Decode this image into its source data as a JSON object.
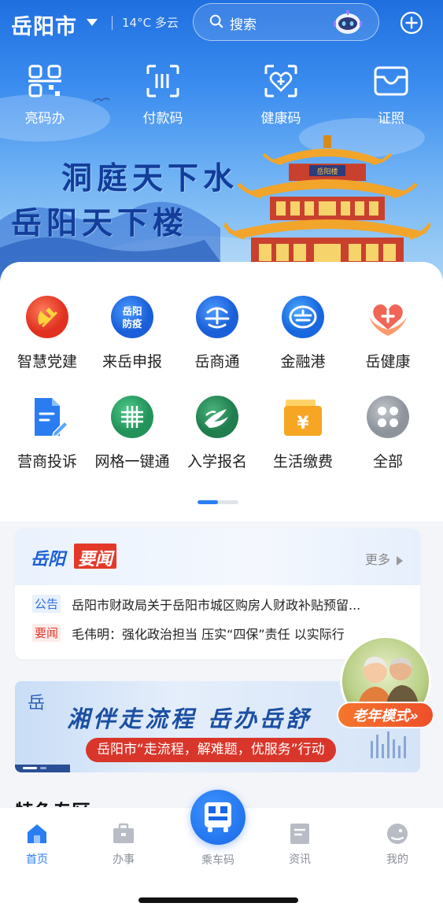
{
  "header": {
    "city": "岳阳市",
    "weather": "14°C 多云",
    "search_placeholder": "搜索"
  },
  "quick_actions": [
    {
      "label": "亮码办",
      "icon": "qr-scan-icon"
    },
    {
      "label": "付款码",
      "icon": "pay-code-icon"
    },
    {
      "label": "健康码",
      "icon": "health-code-icon"
    },
    {
      "label": "证照",
      "icon": "id-card-icon"
    }
  ],
  "hero": {
    "slogan_line1": "洞庭天下水",
    "slogan_line2": "岳阳天下楼",
    "tower_plaque": "岳阳楼"
  },
  "apps": [
    {
      "label": "智慧党建",
      "icon": "party-building-icon",
      "color": "#e8412c",
      "badge": ""
    },
    {
      "label": "来岳申报",
      "icon": "epidemic-prevention-icon",
      "color": "#1f6fe6",
      "badge": "岳阳\n防疫"
    },
    {
      "label": "岳商通",
      "icon": "business-icon",
      "color": "#1f6fe6",
      "badge": ""
    },
    {
      "label": "金融港",
      "icon": "finance-icon",
      "color": "#1f78e8",
      "badge": ""
    },
    {
      "label": "岳健康",
      "icon": "health-heart-icon",
      "color": "#ef5a4e",
      "badge": ""
    },
    {
      "label": "营商投诉",
      "icon": "complaint-doc-icon",
      "color": "#2a7cf0",
      "badge": ""
    },
    {
      "label": "网格一键通",
      "icon": "grid-icon",
      "color": "#2fa86c",
      "badge": ""
    },
    {
      "label": "入学报名",
      "icon": "school-bird-icon",
      "color": "#2f9a64",
      "badge": ""
    },
    {
      "label": "生活缴费",
      "icon": "bill-payment-icon",
      "color": "#f6a623",
      "badge": ""
    },
    {
      "label": "全部",
      "icon": "all-apps-icon",
      "color": "#9aa0a8",
      "badge": ""
    }
  ],
  "news": {
    "brand_left": "岳阳",
    "brand_right": "要闻",
    "more_label": "更多",
    "items": [
      {
        "tag": "公告",
        "tag_color": "blue",
        "text": "岳阳市财政局关于岳阳市城区购房人财政补贴预留..."
      },
      {
        "tag": "要闻",
        "tag_color": "red",
        "text": "毛伟明：强化政治担当 压实“四保”责任 以实际行"
      }
    ]
  },
  "banner": {
    "logo": "岳",
    "title": "湘伴走流程 岳办岳舒",
    "pill": "岳阳市“走流程，解难题，优服务”行动"
  },
  "senior_mode": {
    "label": "老年模式»"
  },
  "next_section_title": "特色专区",
  "tabbar": {
    "items": [
      {
        "label": "首页",
        "icon": "home-icon",
        "active": true
      },
      {
        "label": "办事",
        "icon": "briefcase-icon",
        "active": false
      },
      {
        "label": "乘车码",
        "icon": "bus-code-icon",
        "active": false
      },
      {
        "label": "资讯",
        "icon": "news-icon",
        "active": false
      },
      {
        "label": "我的",
        "icon": "profile-icon",
        "active": false
      }
    ]
  },
  "colors": {
    "primary": "#2b7df4",
    "hero_top": "#1f6fe0",
    "red": "#e4392a"
  }
}
